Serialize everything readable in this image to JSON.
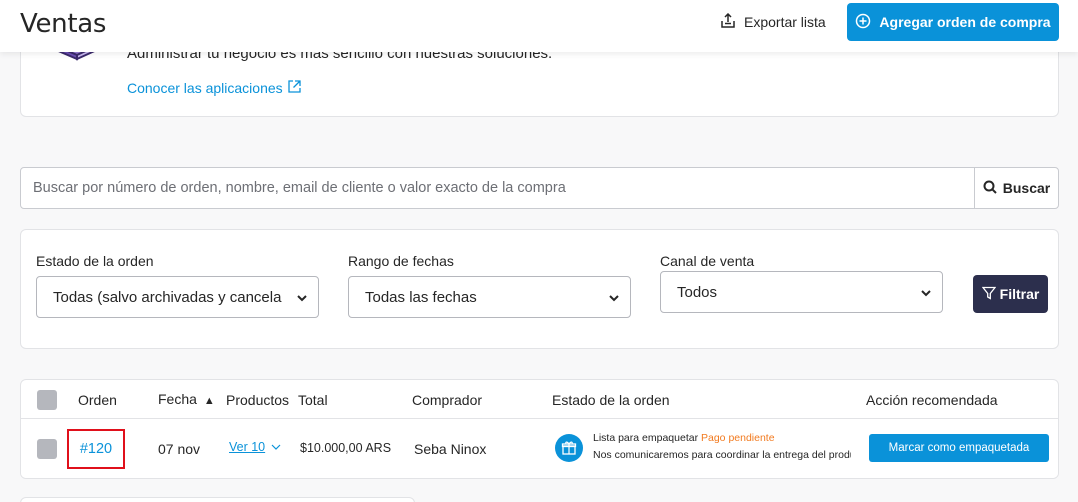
{
  "header": {
    "title": "Ventas",
    "export_label": "Exportar lista",
    "add_order_label": "Agregar orden de compra"
  },
  "promo": {
    "text": "Administrar tu negocio es más sencillo con nuestras soluciones.",
    "link_label": "Conocer las aplicaciones"
  },
  "search": {
    "placeholder": "Buscar por número de orden, nombre, email de cliente o valor exacto de la compra",
    "button_label": "Buscar"
  },
  "filters": {
    "status_label": "Estado de la orden",
    "status_value": "Todas (salvo archivadas y canceladas)",
    "dates_label": "Rango de fechas",
    "dates_value": "Todas las fechas",
    "channel_label": "Canal de venta",
    "channel_value": "Todos",
    "filter_button": "Filtrar"
  },
  "table": {
    "columns": {
      "order": "Orden",
      "date": "Fecha",
      "sort_indicator": "▲",
      "products": "Productos",
      "total": "Total",
      "buyer": "Comprador",
      "status": "Estado de la orden",
      "action": "Acción recomendada"
    },
    "rows": [
      {
        "order": "#120",
        "date": "07 nov",
        "products": "Ver 10",
        "total": "$10.000,00 ARS",
        "buyer": "Seba Ninox",
        "status_main": "Lista para empaquetar",
        "status_payment": "Pago pendiente",
        "status_note": "Nos comunicaremos para coordinar la entrega del producto",
        "action": "Marcar como empaquetada"
      }
    ]
  },
  "colors": {
    "primary": "#0a92d9",
    "dark_button": "#2c2f4d",
    "pending": "#f27a1f",
    "highlight": "#e0101b"
  },
  "icons": [
    "share-export-icon",
    "plus-circle-icon",
    "external-link-icon",
    "search-icon",
    "chevron-down-icon",
    "funnel-icon",
    "gift-box-icon",
    "book-illustration"
  ]
}
